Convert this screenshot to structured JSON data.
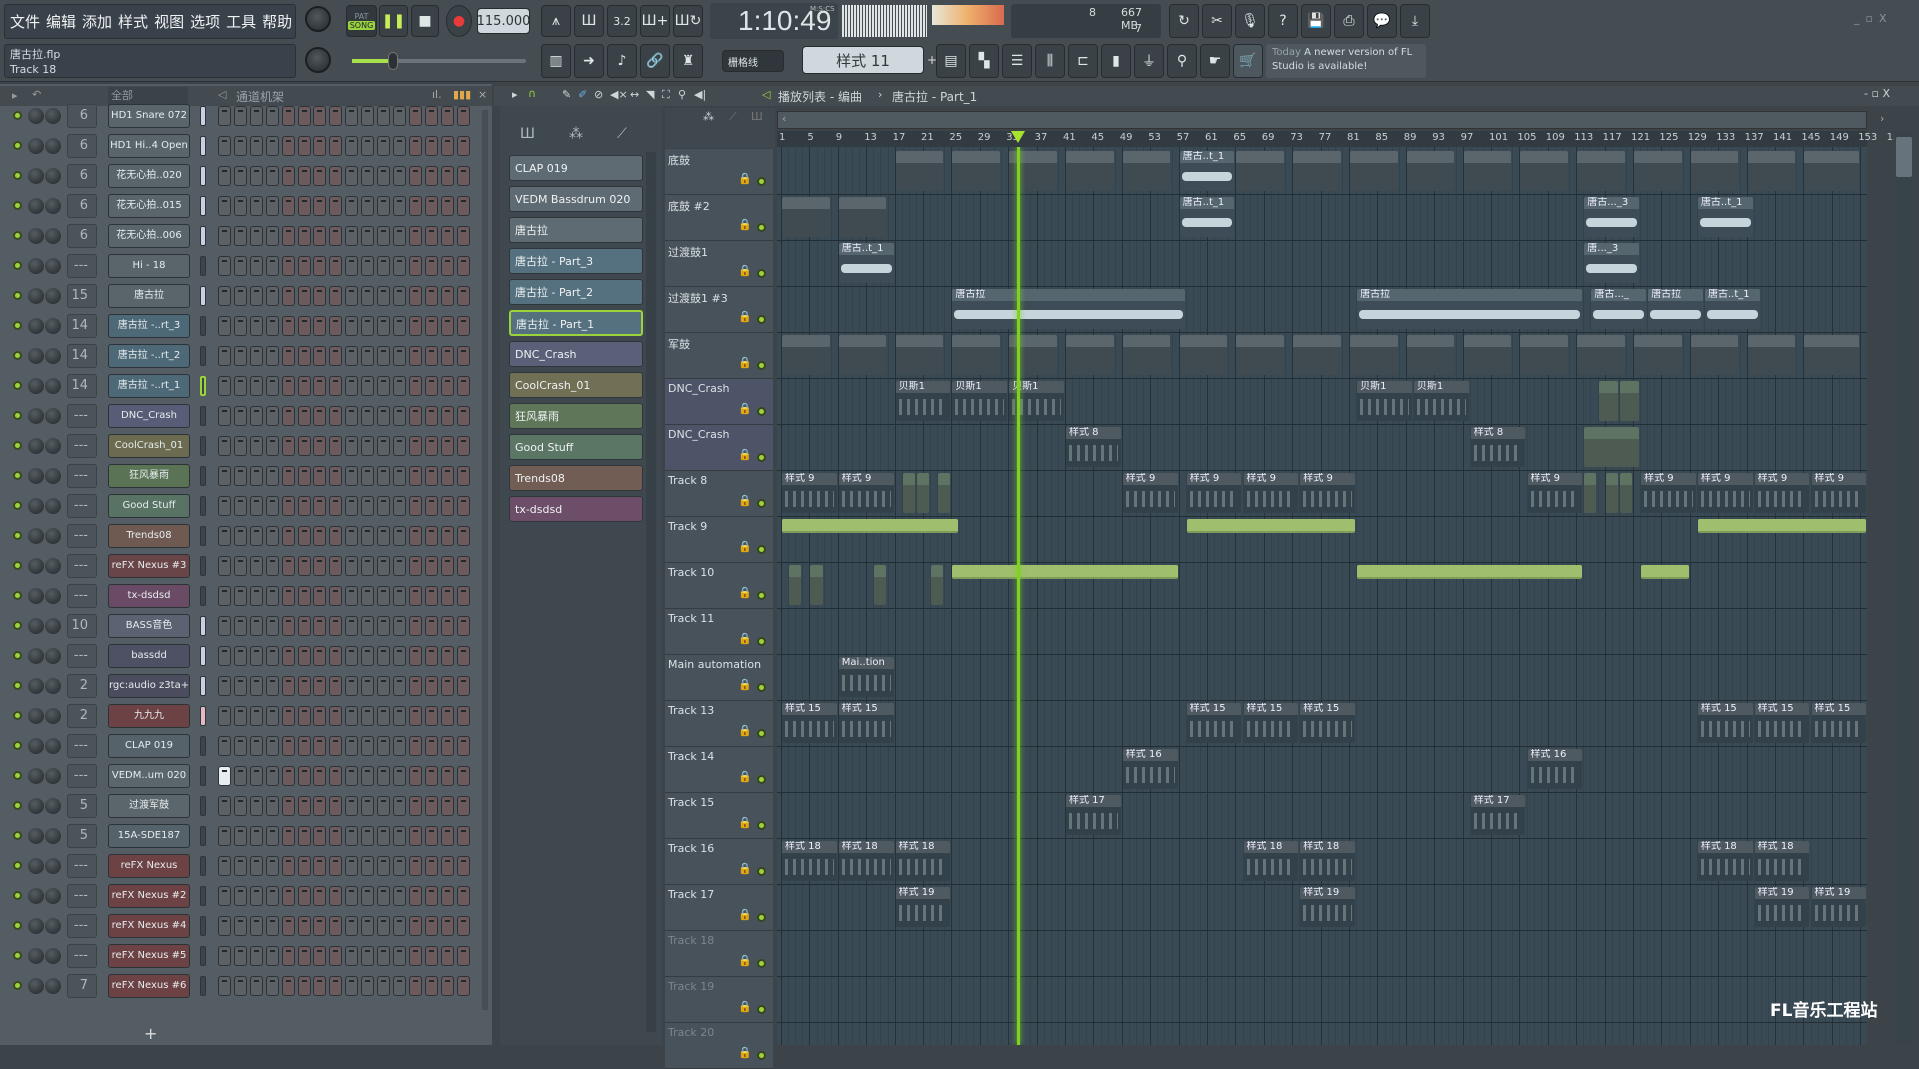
{
  "menu": {
    "items": [
      "文件",
      "编辑",
      "添加",
      "样式",
      "视图",
      "选项",
      "工具",
      "帮助"
    ]
  },
  "file": {
    "name": "唐古拉.flp",
    "hint": "Track 18"
  },
  "transport": {
    "pat": "PAT",
    "song": "SONG",
    "tempo": "115.000",
    "time": "1:10:49",
    "time_unit": "M:S:CS"
  },
  "cpu": {
    "voices": "8",
    "memory": "667 MB",
    "polyphony": "7"
  },
  "snap": {
    "label": "栅格线"
  },
  "pattern_selector": {
    "label": "样式 11",
    "add": "+"
  },
  "news": {
    "day": "Today",
    "text": "A newer version of FL Studio is available!"
  },
  "channel_rack": {
    "filter": "全部",
    "title": "通道机架",
    "add": "+",
    "channels": [
      {
        "num": "6",
        "name": "HD1 Snare 072",
        "color": "#5a656b",
        "lvl": 0.9
      },
      {
        "num": "6",
        "name": "HD1 Hi..4 Open",
        "color": "#5a656b",
        "lvl": 0.9
      },
      {
        "num": "6",
        "name": "花无心拍..020",
        "color": "#5a656b",
        "lvl": 0.9
      },
      {
        "num": "6",
        "name": "花无心拍..015",
        "color": "#5a656b",
        "lvl": 0.9
      },
      {
        "num": "6",
        "name": "花无心拍..006",
        "color": "#5a656b",
        "lvl": 0.9
      },
      {
        "num": "---",
        "name": "Hi - 18",
        "color": "#5a656b",
        "lvl": 0
      },
      {
        "num": "15",
        "name": "唐古拉",
        "color": "#5a656b",
        "lvl": 0.9
      },
      {
        "num": "14",
        "name": "唐古拉 -..rt_3",
        "color": "#4d6876",
        "lvl": 0
      },
      {
        "num": "14",
        "name": "唐古拉 -..rt_2",
        "color": "#4d6876",
        "lvl": 0
      },
      {
        "num": "14",
        "name": "唐古拉 -..rt_1",
        "color": "#4d6876",
        "lvl": 0,
        "selected": true
      },
      {
        "num": "---",
        "name": "DNC_Crash",
        "color": "#585d77",
        "lvl": 0
      },
      {
        "num": "---",
        "name": "CoolCrash_01",
        "color": "#6c6a4f",
        "lvl": 0
      },
      {
        "num": "---",
        "name": "狂风暴雨",
        "color": "#5b7355",
        "lvl": 0
      },
      {
        "num": "---",
        "name": "Good Stuff",
        "color": "#587263",
        "lvl": 0
      },
      {
        "num": "---",
        "name": "Trends08",
        "color": "#6f5a52",
        "lvl": 0
      },
      {
        "num": "---",
        "name": "reFX Nexus #3",
        "color": "#6a4548",
        "lvl": 0
      },
      {
        "num": "---",
        "name": "tx-dsdsd",
        "color": "#6a4b65",
        "lvl": 0
      },
      {
        "num": "10",
        "name": "BASS音色",
        "color": "#5b6272",
        "lvl": 0.9
      },
      {
        "num": "---",
        "name": "bassdd",
        "color": "#4e5064",
        "lvl": 0.9
      },
      {
        "num": "2",
        "name": "rgc:audio z3ta+",
        "color": "#4b4d5f",
        "lvl": 0.9
      },
      {
        "num": "2",
        "name": "九九九",
        "color": "#6c4245",
        "lvl": 0.9,
        "pink": true
      },
      {
        "num": "---",
        "name": "CLAP 019",
        "color": "#56626a",
        "lvl": 0
      },
      {
        "num": "---",
        "name": "VEDM..um 020",
        "color": "#5b666c",
        "lvl": 0,
        "lit": true
      },
      {
        "num": "5",
        "name": "过渡军鼓",
        "color": "#5b666c",
        "lvl": 0
      },
      {
        "num": "5",
        "name": "15A-SDE187",
        "color": "#56626a",
        "lvl": 0
      },
      {
        "num": "---",
        "name": "reFX Nexus",
        "color": "#6c4245",
        "lvl": 0
      },
      {
        "num": "---",
        "name": "reFX Nexus #2",
        "color": "#6c4245",
        "lvl": 0
      },
      {
        "num": "---",
        "name": "reFX Nexus #4",
        "color": "#6c4245",
        "lvl": 0
      },
      {
        "num": "---",
        "name": "reFX Nexus #5",
        "color": "#6c4245",
        "lvl": 0
      },
      {
        "num": "7",
        "name": "reFX Nexus #6",
        "color": "#6c4245",
        "lvl": 0
      }
    ]
  },
  "pattern_picker": {
    "items": [
      {
        "name": "CLAP 019",
        "color": "#5f6b72"
      },
      {
        "name": "VEDM Bassdrum 020",
        "color": "#5f6b72"
      },
      {
        "name": "唐古拉",
        "color": "#5f6b72"
      },
      {
        "name": "唐古拉 - Part_3",
        "color": "#55707e"
      },
      {
        "name": "唐古拉 - Part_2",
        "color": "#55707e"
      },
      {
        "name": "唐古拉 - Part_1",
        "color": "#55707e",
        "selected": true
      },
      {
        "name": "DNC_Crash",
        "color": "#5b6079"
      },
      {
        "name": "CoolCrash_01",
        "color": "#716f55"
      },
      {
        "name": "狂风暴雨",
        "color": "#5f7658"
      },
      {
        "name": "Good Stuff",
        "color": "#5c7666"
      },
      {
        "name": "Trends08",
        "color": "#725d55"
      },
      {
        "name": "tx-dsdsd",
        "color": "#6c4e68"
      }
    ]
  },
  "playlist": {
    "title": "播放列表 - 编曲",
    "breadcrumb": "唐古拉 - Part_1",
    "playhead_bar": 34.2,
    "ruler": [
      "1",
      "5",
      "9",
      "13",
      "17",
      "21",
      "25",
      "29",
      "33",
      "37",
      "41",
      "45",
      "49",
      "53",
      "57",
      "61",
      "65",
      "69",
      "73",
      "77",
      "81",
      "85",
      "89",
      "93",
      "97",
      "101",
      "105",
      "109",
      "113",
      "117",
      "121",
      "125",
      "129",
      "133",
      "137",
      "141",
      "145",
      "149",
      "153",
      "15"
    ],
    "tracks": [
      {
        "name": "底鼓",
        "clips": [
          {
            "s": 17,
            "l": 7,
            "k": "pattern"
          },
          {
            "s": 25,
            "l": 7,
            "k": "pattern"
          },
          {
            "s": 33,
            "l": 7,
            "k": "pattern"
          },
          {
            "s": 41,
            "l": 7,
            "k": "pattern"
          },
          {
            "s": 49,
            "l": 7,
            "k": "pattern"
          },
          {
            "s": 57,
            "l": 8,
            "k": "audio",
            "t": "唐古..t_1"
          },
          {
            "s": 65,
            "l": 7,
            "k": "pattern"
          },
          {
            "s": 73,
            "l": 7,
            "k": "pattern"
          },
          {
            "s": 81,
            "l": 7,
            "k": "pattern"
          },
          {
            "s": 89,
            "l": 7,
            "k": "pattern"
          },
          {
            "s": 97,
            "l": 7,
            "k": "pattern"
          },
          {
            "s": 105,
            "l": 7,
            "k": "pattern"
          },
          {
            "s": 113,
            "l": 7,
            "k": "pattern"
          },
          {
            "s": 121,
            "l": 7,
            "k": "pattern"
          },
          {
            "s": 129,
            "l": 7,
            "k": "pattern"
          },
          {
            "s": 137,
            "l": 7,
            "k": "pattern"
          },
          {
            "s": 145,
            "l": 8,
            "k": "pattern"
          }
        ]
      },
      {
        "name": "底鼓 #2",
        "clips": [
          {
            "s": 1,
            "l": 7,
            "k": "pattern"
          },
          {
            "s": 9,
            "l": 7,
            "k": "pattern"
          },
          {
            "s": 57,
            "l": 8,
            "k": "audio",
            "t": "唐古..t_1"
          },
          {
            "s": 114,
            "l": 8,
            "k": "audio",
            "t": "唐古..._3"
          },
          {
            "s": 130,
            "l": 8,
            "k": "audio",
            "t": "唐古..t_1"
          }
        ]
      },
      {
        "name": "过渡鼓1",
        "clips": [
          {
            "s": 9,
            "l": 8,
            "k": "audio",
            "t": "唐古..t_1"
          },
          {
            "s": 114,
            "l": 8,
            "k": "audio",
            "t": "唐..._3"
          }
        ]
      },
      {
        "name": "过渡鼓1 #3",
        "clips": [
          {
            "s": 25,
            "l": 33,
            "k": "audio",
            "t": "唐古拉"
          },
          {
            "s": 82,
            "l": 32,
            "k": "audio",
            "t": "唐古拉"
          },
          {
            "s": 115,
            "l": 8,
            "k": "audio",
            "t": "唐古..._"
          },
          {
            "s": 123,
            "l": 8,
            "k": "audio",
            "t": "唐古拉"
          },
          {
            "s": 131,
            "l": 8,
            "k": "audio",
            "t": "唐古..t_1"
          }
        ]
      },
      {
        "name": "军鼓",
        "clips": [
          {
            "s": 1,
            "l": 7,
            "k": "pattern"
          },
          {
            "s": 9,
            "l": 7,
            "k": "pattern"
          },
          {
            "s": 17,
            "l": 7,
            "k": "pattern"
          },
          {
            "s": 25,
            "l": 7,
            "k": "pattern"
          },
          {
            "s": 33,
            "l": 7,
            "k": "pattern"
          },
          {
            "s": 41,
            "l": 7,
            "k": "pattern"
          },
          {
            "s": 49,
            "l": 7,
            "k": "pattern"
          },
          {
            "s": 57,
            "l": 7,
            "k": "pattern"
          },
          {
            "s": 65,
            "l": 7,
            "k": "pattern"
          },
          {
            "s": 73,
            "l": 7,
            "k": "pattern"
          },
          {
            "s": 81,
            "l": 7,
            "k": "pattern"
          },
          {
            "s": 89,
            "l": 7,
            "k": "pattern"
          },
          {
            "s": 97,
            "l": 7,
            "k": "pattern"
          },
          {
            "s": 105,
            "l": 7,
            "k": "pattern"
          },
          {
            "s": 113,
            "l": 7,
            "k": "pattern"
          },
          {
            "s": 121,
            "l": 7,
            "k": "pattern"
          },
          {
            "s": 129,
            "l": 7,
            "k": "pattern"
          },
          {
            "s": 137,
            "l": 7,
            "k": "pattern"
          },
          {
            "s": 145,
            "l": 8,
            "k": "pattern"
          }
        ]
      },
      {
        "name": "DNC_Crash",
        "clips": [
          {
            "s": 17,
            "l": 8,
            "k": "notes",
            "t": "贝斯1"
          },
          {
            "s": 25,
            "l": 8,
            "k": "notes",
            "t": "贝斯1"
          },
          {
            "s": 33,
            "l": 8,
            "k": "notes",
            "t": "贝斯1"
          },
          {
            "s": 82,
            "l": 8,
            "k": "notes",
            "t": "贝斯1"
          },
          {
            "s": 90,
            "l": 8,
            "k": "notes",
            "t": "贝斯1"
          },
          {
            "s": 116,
            "l": 3,
            "k": "slice"
          },
          {
            "s": 119,
            "l": 3,
            "k": "slice"
          }
        ]
      },
      {
        "name": "DNC_Crash",
        "clips": [
          {
            "s": 41,
            "l": 8,
            "k": "notes",
            "t": "样式 8"
          },
          {
            "s": 98,
            "l": 8,
            "k": "notes",
            "t": "样式 8"
          },
          {
            "s": 114,
            "l": 8,
            "k": "slice"
          }
        ]
      },
      {
        "name": "Track 8",
        "clips": [
          {
            "s": 1,
            "l": 8,
            "k": "notes",
            "t": "样式 9"
          },
          {
            "s": 9,
            "l": 8,
            "k": "notes",
            "t": "样式 9"
          },
          {
            "s": 18,
            "l": 2,
            "k": "slice"
          },
          {
            "s": 20,
            "l": 2,
            "k": "slice"
          },
          {
            "s": 23,
            "l": 2,
            "k": "slice"
          },
          {
            "s": 49,
            "l": 8,
            "k": "notes",
            "t": "样式 9"
          },
          {
            "s": 58,
            "l": 8,
            "k": "notes",
            "t": "样式 9"
          },
          {
            "s": 66,
            "l": 8,
            "k": "notes",
            "t": "样式 9"
          },
          {
            "s": 74,
            "l": 8,
            "k": "notes",
            "t": "样式 9"
          },
          {
            "s": 106,
            "l": 8,
            "k": "notes",
            "t": "样式 9"
          },
          {
            "s": 114,
            "l": 2,
            "k": "slice"
          },
          {
            "s": 117,
            "l": 2,
            "k": "slice"
          },
          {
            "s": 119,
            "l": 2,
            "k": "slice"
          },
          {
            "s": 122,
            "l": 8,
            "k": "notes",
            "t": "样式 9"
          },
          {
            "s": 130,
            "l": 8,
            "k": "notes",
            "t": "样式 9"
          },
          {
            "s": 138,
            "l": 8,
            "k": "notes",
            "t": "样式 9"
          },
          {
            "s": 146,
            "l": 8,
            "k": "notes",
            "t": "样式 9"
          }
        ]
      },
      {
        "name": "Track 9",
        "clips": [
          {
            "s": 1,
            "l": 25,
            "k": "green"
          },
          {
            "s": 58,
            "l": 24,
            "k": "green"
          },
          {
            "s": 130,
            "l": 24,
            "k": "green"
          }
        ]
      },
      {
        "name": "Track 10",
        "clips": [
          {
            "s": 2,
            "l": 2,
            "k": "slice"
          },
          {
            "s": 5,
            "l": 2,
            "k": "slice"
          },
          {
            "s": 14,
            "l": 2,
            "k": "slice"
          },
          {
            "s": 22,
            "l": 2,
            "k": "slice"
          },
          {
            "s": 25,
            "l": 32,
            "k": "green"
          },
          {
            "s": 82,
            "l": 32,
            "k": "green"
          },
          {
            "s": 122,
            "l": 7,
            "k": "green"
          }
        ]
      },
      {
        "name": "Track 11",
        "clips": []
      },
      {
        "name": "Main automation",
        "clips": [
          {
            "s": 9,
            "l": 8,
            "k": "notes",
            "t": "Mai..tion"
          }
        ]
      },
      {
        "name": "Track 13",
        "clips": [
          {
            "s": 1,
            "l": 8,
            "k": "notes",
            "t": "样式 15"
          },
          {
            "s": 9,
            "l": 8,
            "k": "notes",
            "t": "样式 15"
          },
          {
            "s": 58,
            "l": 8,
            "k": "notes",
            "t": "样式 15"
          },
          {
            "s": 66,
            "l": 8,
            "k": "notes",
            "t": "样式 15"
          },
          {
            "s": 74,
            "l": 8,
            "k": "notes",
            "t": "样式 15"
          },
          {
            "s": 130,
            "l": 8,
            "k": "notes",
            "t": "样式 15"
          },
          {
            "s": 138,
            "l": 8,
            "k": "notes",
            "t": "样式 15"
          },
          {
            "s": 146,
            "l": 8,
            "k": "notes",
            "t": "样式 15"
          }
        ]
      },
      {
        "name": "Track 14",
        "clips": [
          {
            "s": 49,
            "l": 8,
            "k": "notes",
            "t": "样式 16"
          },
          {
            "s": 106,
            "l": 8,
            "k": "notes",
            "t": "样式 16"
          }
        ]
      },
      {
        "name": "Track 15",
        "clips": [
          {
            "s": 41,
            "l": 8,
            "k": "notes",
            "t": "样式 17"
          },
          {
            "s": 98,
            "l": 8,
            "k": "notes",
            "t": "样式 17"
          }
        ]
      },
      {
        "name": "Track 16",
        "clips": [
          {
            "s": 1,
            "l": 8,
            "k": "notes",
            "t": "样式 18"
          },
          {
            "s": 9,
            "l": 8,
            "k": "notes",
            "t": "样式 18"
          },
          {
            "s": 17,
            "l": 8,
            "k": "notes",
            "t": "样式 18"
          },
          {
            "s": 66,
            "l": 8,
            "k": "notes",
            "t": "样式 18"
          },
          {
            "s": 74,
            "l": 8,
            "k": "notes",
            "t": "样式 18"
          },
          {
            "s": 130,
            "l": 8,
            "k": "notes",
            "t": "样式 18"
          },
          {
            "s": 138,
            "l": 8,
            "k": "notes",
            "t": "样式 18"
          }
        ]
      },
      {
        "name": "Track 17",
        "clips": [
          {
            "s": 17,
            "l": 8,
            "k": "notes",
            "t": "样式 19"
          },
          {
            "s": 74,
            "l": 8,
            "k": "notes",
            "t": "样式 19"
          },
          {
            "s": 138,
            "l": 8,
            "k": "notes",
            "t": "样式 19"
          },
          {
            "s": 146,
            "l": 8,
            "k": "notes",
            "t": "样式 19"
          }
        ]
      },
      {
        "name": "Track 18",
        "clips": [],
        "dim": true
      },
      {
        "name": "Track 19",
        "clips": [],
        "dim": true
      },
      {
        "name": "Track 20",
        "clips": [],
        "dim": true
      }
    ]
  },
  "watermark": "FL音乐工程站",
  "colors": {
    "accent": "#9ad43a",
    "playhead": "#7ed321",
    "grid_bg": "#394a55"
  }
}
